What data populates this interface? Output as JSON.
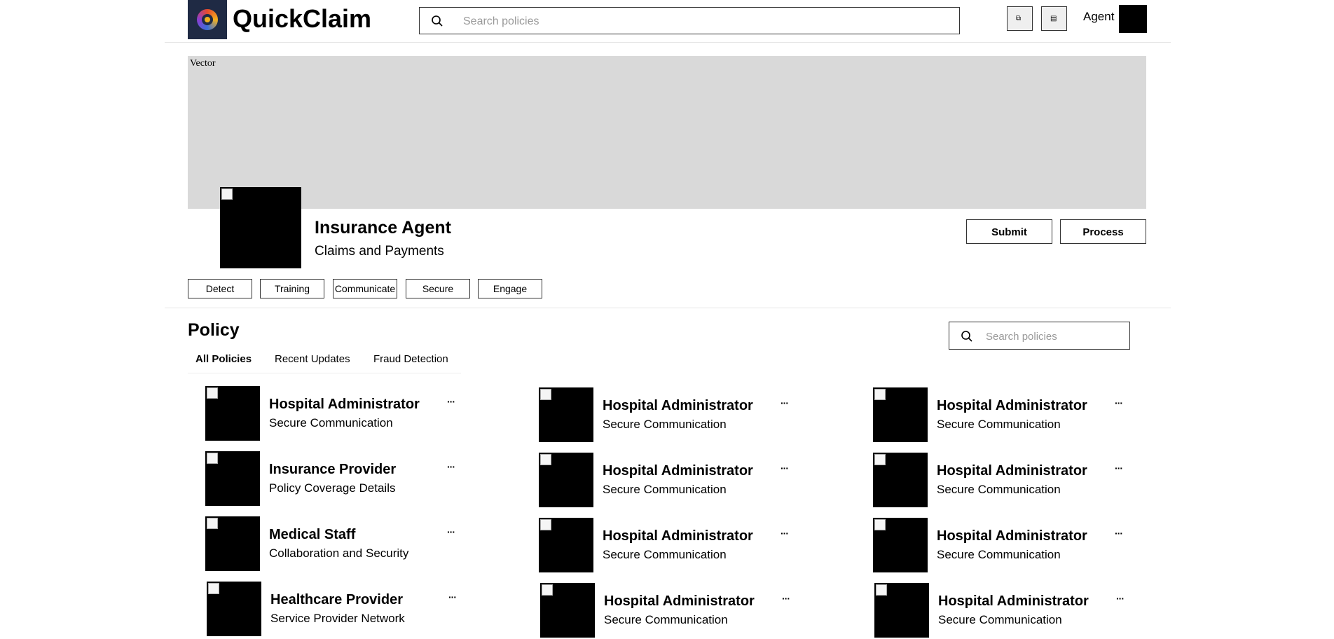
{
  "header": {
    "brand": "QuickClaim",
    "search_placeholder": "Search policies",
    "agent_label": "Agent"
  },
  "banner": {
    "alt_text": "Vector"
  },
  "profile": {
    "name": "Insurance Agent",
    "subtitle": "Claims and Payments",
    "actions": [
      "Submit",
      "Process"
    ],
    "tags": [
      "Detect",
      "Training",
      "Communicate",
      "Secure",
      "Engage"
    ]
  },
  "policy": {
    "title": "Policy",
    "search_placeholder": "Search policies",
    "tabs": [
      "All Policies",
      "Recent Updates",
      "Fraud Detection"
    ],
    "columns": [
      [
        {
          "title": "Hospital Administrator",
          "subtitle": "Secure Communication"
        },
        {
          "title": "Insurance Provider",
          "subtitle": "Policy Coverage Details"
        },
        {
          "title": "Medical Staff",
          "subtitle": "Collaboration and Security"
        },
        {
          "title": "Healthcare Provider",
          "subtitle": "Service Provider Network"
        }
      ],
      [
        {
          "title": "Hospital Administrator",
          "subtitle": "Secure Communication"
        },
        {
          "title": "Hospital Administrator",
          "subtitle": "Secure Communication"
        },
        {
          "title": "Hospital Administrator",
          "subtitle": "Secure Communication"
        },
        {
          "title": "Hospital Administrator",
          "subtitle": "Secure Communication"
        }
      ],
      [
        {
          "title": "Hospital Administrator",
          "subtitle": "Secure Communication"
        },
        {
          "title": "Hospital Administrator",
          "subtitle": "Secure Communication"
        },
        {
          "title": "Hospital Administrator",
          "subtitle": "Secure Communication"
        },
        {
          "title": "Hospital Administrator",
          "subtitle": "Secure Communication"
        }
      ]
    ],
    "more_label": "···"
  }
}
